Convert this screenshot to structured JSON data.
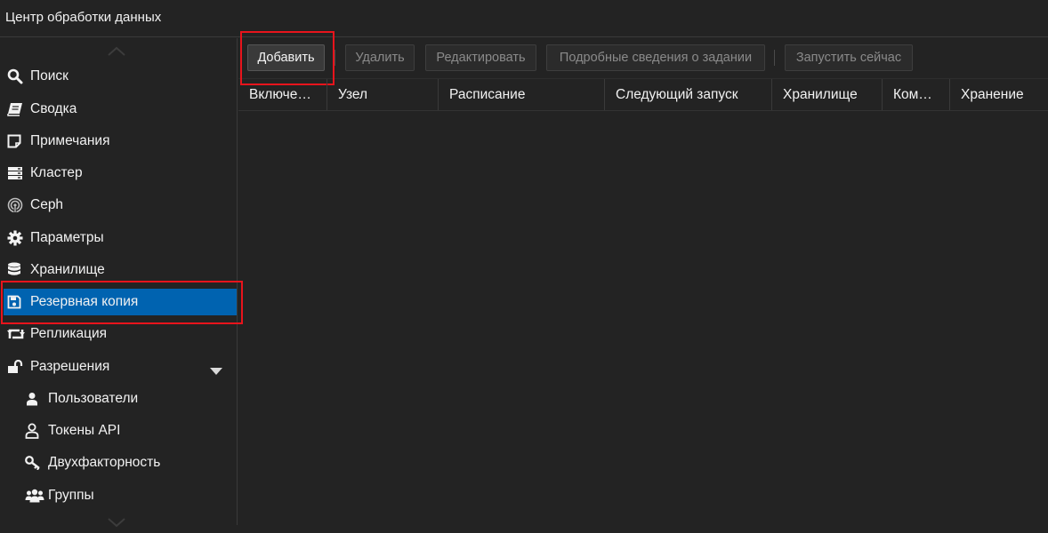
{
  "header": {
    "title": "Центр обработки данных"
  },
  "sidebar": {
    "items": [
      {
        "label": "Поиск",
        "icon": "search-icon"
      },
      {
        "label": "Сводка",
        "icon": "book-icon"
      },
      {
        "label": "Примечания",
        "icon": "sticky-note-icon"
      },
      {
        "label": "Кластер",
        "icon": "server-icon"
      },
      {
        "label": "Ceph",
        "icon": "ceph-icon"
      },
      {
        "label": "Параметры",
        "icon": "gear-icon"
      },
      {
        "label": "Хранилище",
        "icon": "database-icon"
      },
      {
        "label": "Резервная копия",
        "icon": "floppy-disk-icon",
        "selected": true
      },
      {
        "label": "Репликация",
        "icon": "retweet-icon"
      },
      {
        "label": "Разрешения",
        "icon": "unlock-icon",
        "expanded": true
      },
      {
        "label": "Пользователи",
        "icon": "user-icon"
      },
      {
        "label": "Токены API",
        "icon": "user-outline-icon"
      },
      {
        "label": "Двухфакторность",
        "icon": "key-icon"
      },
      {
        "label": "Группы",
        "icon": "users-icon"
      }
    ]
  },
  "toolbar": {
    "add": "Добавить",
    "remove": "Удалить",
    "edit": "Редактировать",
    "job_details": "Подробные сведения о задании",
    "run_now": "Запустить сейчас"
  },
  "table": {
    "columns": [
      "Включе…",
      "Узел",
      "Расписание",
      "Следующий запуск",
      "Хранилище",
      "Ком…",
      "Хранение"
    ]
  },
  "colors": {
    "selected": "#0063b0",
    "highlight": "#e8141c",
    "background": "#232323"
  }
}
